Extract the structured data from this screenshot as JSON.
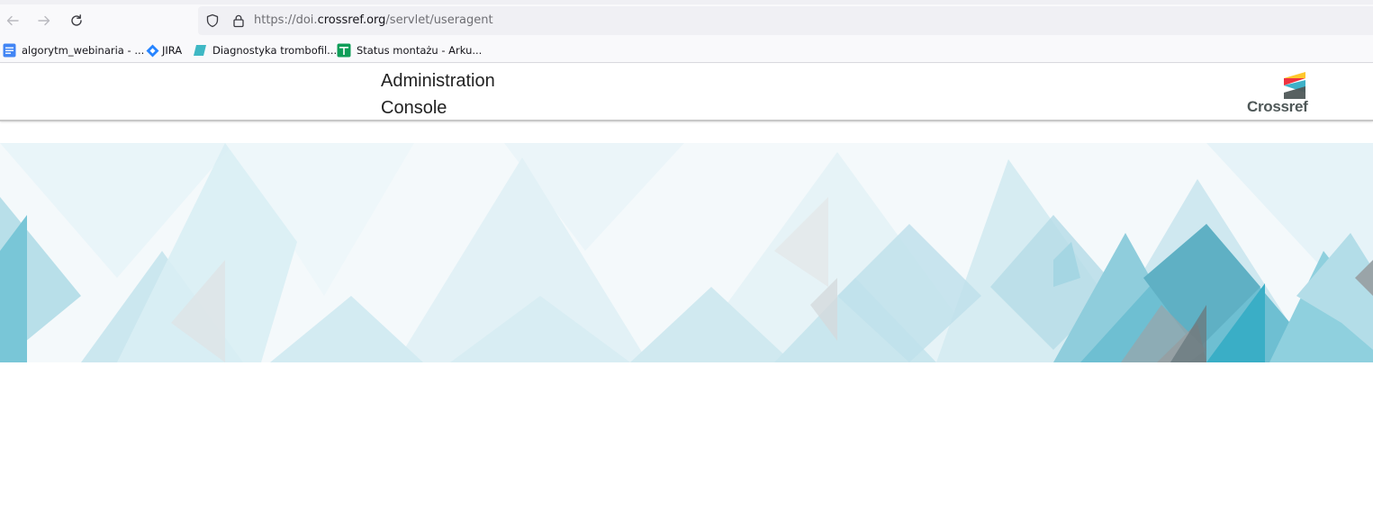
{
  "browser": {
    "url_prefix": "https://doi.",
    "url_host": "crossref.org",
    "url_path": "/servlet/useragent",
    "nav": {
      "back_icon": "arrow-left-icon",
      "forward_icon": "arrow-right-icon",
      "reload_icon": "reload-icon"
    },
    "bookmarks": [
      {
        "label": "algorytm_webinaria - ...",
        "icon": "google-docs-icon",
        "color": "#4285f4"
      },
      {
        "label": "JIRA",
        "icon": "jira-icon",
        "color": "#2684ff"
      },
      {
        "label": "Diagnostyka trombofil...",
        "icon": "folder-teal-icon",
        "color": "#3fb8c4"
      },
      {
        "label": "Status montażu - Arku...",
        "icon": "google-sheets-icon",
        "color": "#0f9d58"
      }
    ]
  },
  "page": {
    "title": "Administration Console",
    "logo_text": "Crossref",
    "logo_colors": {
      "yellow": "#ffc72c",
      "red": "#ef3340",
      "teal": "#3eb1c8",
      "gray": "#4f5858"
    },
    "banner_colors": {
      "light": "#dff0f5",
      "mid": "#9fd3e0",
      "dark": "#3aaec6",
      "gray": "#9aa4a8"
    }
  }
}
